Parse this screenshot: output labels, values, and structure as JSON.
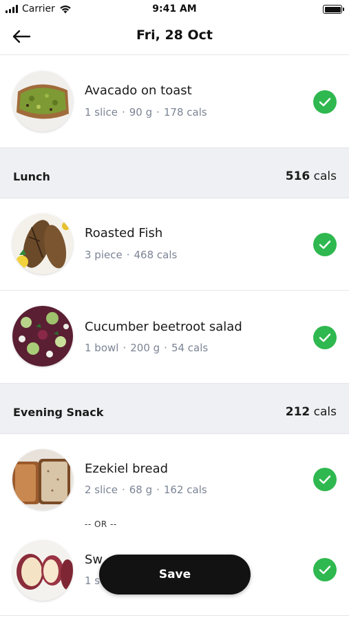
{
  "status_bar": {
    "carrier": "Carrier",
    "time": "9:41 AM"
  },
  "header": {
    "title": "Fri, 28 Oct",
    "back_icon": "arrow-left-icon"
  },
  "breakfast_items": [
    {
      "name": "Avacado on toast",
      "qty": "1 slice",
      "weight": "90 g",
      "cals": "178 cals",
      "checked": true
    }
  ],
  "sections": [
    {
      "title": "Lunch",
      "cal_value": "516",
      "cal_unit": "cals",
      "items": [
        {
          "name": "Roasted Fish",
          "qty": "3 piece",
          "cals": "468 cals",
          "checked": true
        },
        {
          "name": "Cucumber beetroot salad",
          "qty": "1 bowl",
          "weight": "200 g",
          "cals": "54 cals",
          "checked": true
        }
      ]
    },
    {
      "title": "Evening Snack",
      "cal_value": "212",
      "cal_unit": "cals",
      "items": [
        {
          "name": "Ezekiel bread",
          "qty": "2 slice",
          "weight": "68 g",
          "cals": "162 cals",
          "checked": true
        },
        {
          "name": "Sw",
          "qty": "1 s",
          "checked": true
        }
      ],
      "separator": "-- OR --"
    }
  ],
  "save_button": {
    "label": "Save"
  },
  "colors": {
    "accent_green": "#2fb84f",
    "section_bg": "#eef0f3",
    "meta_text": "#7b8494",
    "button_bg": "#121212"
  }
}
